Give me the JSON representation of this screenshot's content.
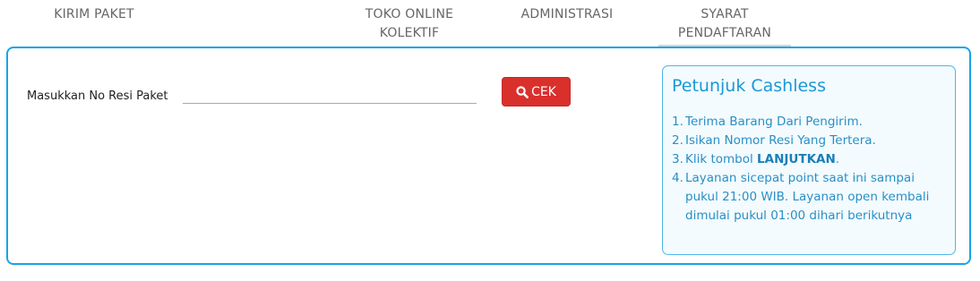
{
  "tabs": [
    {
      "label": "KIRIM PAKET"
    },
    {
      "label": "TOKO ONLINE"
    },
    {
      "label": "TOKO ONLINE KOLEKTIF",
      "line1": "TOKO ONLINE",
      "line2": "KOLEKTIF"
    },
    {
      "label": "ADMINISTRASI"
    },
    {
      "label": "SYARAT PENDAFTARAN",
      "line1": "SYARAT",
      "line2": "PENDAFTARAN"
    }
  ],
  "form": {
    "resi_label": "Masukkan No Resi Paket",
    "resi_value": "",
    "check_button": "CEK",
    "check_icon": "search-icon"
  },
  "guide": {
    "title": "Petunjuk Cashless",
    "steps": [
      {
        "num": "1.",
        "text": "Terima Barang Dari Pengirim."
      },
      {
        "num": "2.",
        "text": "Isikan Nomor Resi Yang Tertera."
      },
      {
        "num": "3.",
        "prefix": "Klik tombol ",
        "bold": "LANJUTKAN",
        "suffix": "."
      },
      {
        "num": "4.",
        "text": "Layanan sicepat point saat ini sampai pukul 21:00 WIB. Layanan open kembali dimulai pukul 01:00 dihari berikutnya"
      }
    ]
  },
  "colors": {
    "accent": "#1aa3ea",
    "button": "#d9302c"
  }
}
